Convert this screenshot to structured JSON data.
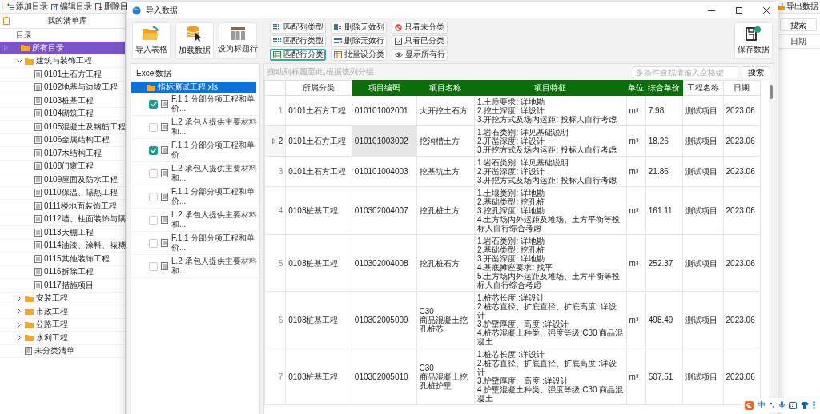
{
  "background_app": {
    "toolbar": [
      {
        "label": "添加目录",
        "kind": "add"
      },
      {
        "label": "编辑目录",
        "kind": "edit"
      },
      {
        "label": "删除目",
        "kind": "delete"
      }
    ],
    "export_button": "导出数据",
    "library_title": "我的清单库",
    "tree_header": "目录",
    "tree": [
      {
        "label": "所有目录",
        "kind": "folder",
        "selected": true,
        "expanded": true,
        "children": [
          {
            "label": "建筑与装饰工程",
            "kind": "folder",
            "selected": false,
            "expanded": true,
            "children": [
              {
                "label": "0101土石方工程",
                "kind": "list",
                "selected": false
              },
              {
                "label": "0102地基与边坡工程",
                "kind": "list",
                "selected": false
              },
              {
                "label": "0103桩基工程",
                "kind": "list",
                "selected": false
              },
              {
                "label": "0104砌筑工程",
                "kind": "list",
                "selected": false
              },
              {
                "label": "0105混凝土及钢筋工程",
                "kind": "list",
                "selected": false
              },
              {
                "label": "0106金属结构工程",
                "kind": "list",
                "selected": false
              },
              {
                "label": "0107木结构工程",
                "kind": "list",
                "selected": false
              },
              {
                "label": "0108门窗工程",
                "kind": "list",
                "selected": false
              },
              {
                "label": "0109屋面及防水工程",
                "kind": "list",
                "selected": false
              },
              {
                "label": "0110保温、隔热工程",
                "kind": "list",
                "selected": false
              },
              {
                "label": "0111楼地面装饰工程",
                "kind": "list",
                "selected": false
              },
              {
                "label": "0112墙、柱面装饰与隔",
                "kind": "list",
                "selected": false
              },
              {
                "label": "0113天棚工程",
                "kind": "list",
                "selected": false
              },
              {
                "label": "0114油漆、涂料、裱糊",
                "kind": "list",
                "selected": false
              },
              {
                "label": "0115其他装饰工程",
                "kind": "list",
                "selected": false
              },
              {
                "label": "0116拆除工程",
                "kind": "list",
                "selected": false
              },
              {
                "label": "0117措施项目",
                "kind": "list",
                "selected": false
              }
            ]
          },
          {
            "label": "安装工程",
            "kind": "folder",
            "selected": false,
            "expanded": false
          },
          {
            "label": "市政工程",
            "kind": "folder",
            "selected": false,
            "expanded": false
          },
          {
            "label": "公路工程",
            "kind": "folder",
            "selected": false,
            "expanded": false
          },
          {
            "label": "水利工程",
            "kind": "folder",
            "selected": false,
            "expanded": false
          },
          {
            "label": "未分类清单",
            "kind": "list",
            "selected": false
          }
        ]
      }
    ],
    "search_button": "搜索",
    "column_header": "日期"
  },
  "dialog": {
    "title": "导入数据",
    "main_buttons": [
      {
        "label": "导入表格",
        "kind": "import"
      },
      {
        "label": "加载数据",
        "kind": "load"
      },
      {
        "label": "设为标题行",
        "kind": "header"
      }
    ],
    "tool_buttons": [
      {
        "label": "匹配列类型",
        "kind": "columns",
        "focused": false
      },
      {
        "label": "删除无效列",
        "kind": "delete-columns",
        "focused": false
      },
      {
        "label": "只看未分类",
        "kind": "no",
        "focused": false
      },
      {
        "label": "匹配行类型",
        "kind": "rows",
        "focused": false
      },
      {
        "label": "删除无效行",
        "kind": "delete-rows",
        "focused": false
      },
      {
        "label": "只看已分类",
        "kind": "check",
        "focused": false
      },
      {
        "label": "匹配行分类",
        "kind": "classify",
        "focused": true
      },
      {
        "label": "批量设分类",
        "kind": "batch",
        "focused": false
      },
      {
        "label": "显示所有行",
        "kind": "eye",
        "focused": false
      }
    ],
    "save_button": "保存数据",
    "excel_panel": {
      "title": "Excel数据",
      "file": {
        "label": "指标测试工程.xls",
        "selected": true,
        "expanded": true
      },
      "sheets": [
        {
          "label": "F.1.1 分部分项工程和单价...",
          "checked": true
        },
        {
          "label": "L.2 承包人提供主要材料和...",
          "checked": false
        },
        {
          "label": "F.1.1 分部分项工程和单价...",
          "checked": true
        },
        {
          "label": "L.2 承包人提供主要材料和...",
          "checked": false
        },
        {
          "label": "F.1.1 分部分项工程和单价...",
          "checked": false
        },
        {
          "label": "L.2 承包人提供主要材料和...",
          "checked": false
        },
        {
          "label": "F.1.1 分部分项工程和单价...",
          "checked": false
        },
        {
          "label": "L.2 承包人提供主要材料和...",
          "checked": false
        }
      ]
    },
    "group_hint": "拖动列标题至此,根据该列分组",
    "search": {
      "placeholder": "多条件查找请输入空格键"
    },
    "search_button": "搜索",
    "table": {
      "columns": [
        {
          "label": "所属分类",
          "matched": false
        },
        {
          "label": "项目编码",
          "matched": true
        },
        {
          "label": "项目名称",
          "matched": true
        },
        {
          "label": "项目特征",
          "matched": true
        },
        {
          "label": "单位",
          "matched": true
        },
        {
          "label": "综合单价",
          "matched": true
        },
        {
          "label": "工程名称",
          "matched": false
        },
        {
          "label": "日期",
          "matched": false
        }
      ],
      "rows": [
        {
          "number": "1",
          "current": false,
          "code_cell_selected": false,
          "cells": [
            "0101土石方工程",
            "010101002001",
            "大开挖土石方",
            "1.土质要求: 详地勘\n2.挖土深度: 详设计\n3.开挖方式及场内运距: 投标人自行考虑",
            "m³",
            "7.98",
            "测试项目",
            "2023.06"
          ]
        },
        {
          "number": "2",
          "current": true,
          "code_cell_selected": true,
          "cells": [
            "0101土石方工程",
            "010101003002",
            "挖沟槽土方",
            "1.岩石类别: 详见基础说明\n2.开凿深度: 详设计\n3.开挖方式及场内运距: 投标人自行考虑",
            "m³",
            "18.26",
            "测试项目",
            "2023.06"
          ]
        },
        {
          "number": "3",
          "current": false,
          "code_cell_selected": false,
          "cells": [
            "0101土石方工程",
            "010101004003",
            "挖基坑土方",
            "1.岩石类别: 详见基础说明\n2.开凿深度: 详设计\n3.开挖方式及场内运距: 投标人自行考虑",
            "m³",
            "21.86",
            "测试项目",
            "2023.06"
          ]
        },
        {
          "number": "4",
          "current": false,
          "code_cell_selected": false,
          "cells": [
            "0103桩基工程",
            "010302004007",
            "挖孔桩土方",
            "1.土壤类别: 详地勘\n2.基础类型: 挖孔桩\n3.挖孔深度: 详地勘\n4.土方场内外运距及堆场、土方平衡等投标人自行综合考虑",
            "m³",
            "161.11",
            "测试项目",
            "2023.06"
          ]
        },
        {
          "number": "5",
          "current": false,
          "code_cell_selected": false,
          "cells": [
            "0103桩基工程",
            "010302004008",
            "挖孔桩石方",
            "1.岩石类别: 详地勘\n2.基础类型: 挖孔桩\n3.开凿深度: 详地勘\n4.基底摊座要求: 找平\n5.土方场内外运距及堆场、土方平衡等投标人自行综合考虑",
            "m³",
            "252.37",
            "测试项目",
            "2023.06"
          ]
        },
        {
          "number": "6",
          "current": false,
          "code_cell_selected": false,
          "cells": [
            "0103桩基工程",
            "010302005009",
            "C30\n商品混凝土挖孔桩芯",
            "1.桩芯长度 :详设计\n2.桩芯直径、扩底直径、扩底高度 :详设计\n3.护壁厚度、高度 :详设计\n4.桩芯混凝土种类、强度等级:C30 商品混凝土",
            "m³",
            "498.49",
            "测试项目",
            "2023.06"
          ]
        },
        {
          "number": "7",
          "current": false,
          "code_cell_selected": false,
          "cells": [
            "0103桩基工程",
            "010302005010",
            "C30\n商品混凝土挖孔桩护壁",
            "1.桩芯长度 :详设计\n2.桩芯直径、扩底直径、扩底高度 :详设计\n3.护壁厚度、高度 :详设计\n4.护壁混凝土种类、强度等级:C30 商品混凝土",
            "m³",
            "507.51",
            "测试项目",
            "2023.06"
          ]
        }
      ]
    }
  },
  "ime_bar": {
    "mode": "中"
  }
}
